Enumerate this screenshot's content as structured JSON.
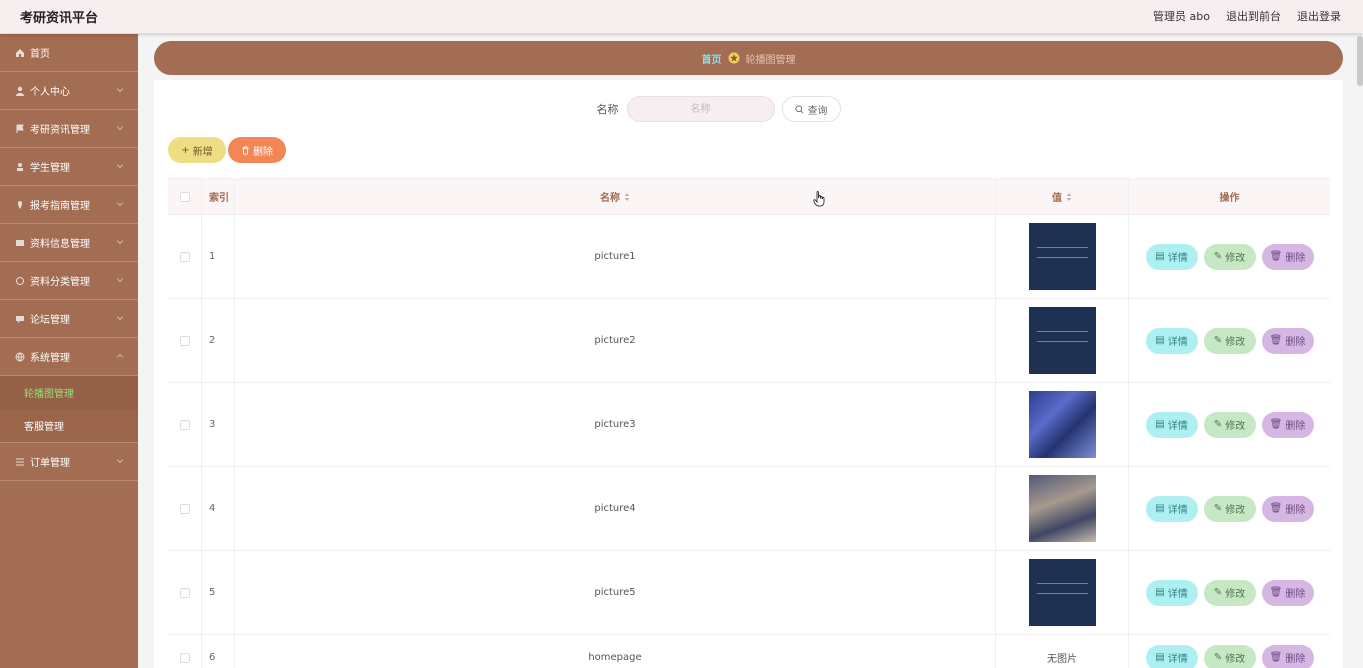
{
  "app": {
    "title": "考研资讯平台",
    "admin_label": "管理员 abo",
    "front_link": "退出到前台",
    "logout_link": "退出登录"
  },
  "sidebar": {
    "items": [
      {
        "label": "首页",
        "icon": "home-icon"
      },
      {
        "label": "个人中心",
        "icon": "user-icon"
      },
      {
        "label": "考研资讯管理",
        "icon": "flag-icon"
      },
      {
        "label": "学生管理",
        "icon": "student-icon"
      },
      {
        "label": "报考指南管理",
        "icon": "guide-icon"
      },
      {
        "label": "资料信息管理",
        "icon": "document-icon"
      },
      {
        "label": "资料分类管理",
        "icon": "category-icon"
      },
      {
        "label": "论坛管理",
        "icon": "forum-icon"
      },
      {
        "label": "系统管理",
        "icon": "globe-icon"
      }
    ],
    "system_sub": [
      {
        "label": "轮播图管理",
        "active": true
      },
      {
        "label": "客服管理",
        "active": false
      }
    ],
    "last_item": {
      "label": "订单管理",
      "icon": "order-icon"
    }
  },
  "breadcrumb": {
    "home": "首页",
    "current": "轮播图管理"
  },
  "search": {
    "label": "名称",
    "placeholder": "名称",
    "query_button": "查询"
  },
  "actions": {
    "add": "新增",
    "delete": "删除"
  },
  "table": {
    "headers": {
      "index": "索引",
      "name": "名称",
      "value": "值",
      "ops": "操作"
    },
    "rows": [
      {
        "index": "1",
        "name": "picture1",
        "thumb": "dark"
      },
      {
        "index": "2",
        "name": "picture2",
        "thumb": "dark"
      },
      {
        "index": "3",
        "name": "picture3",
        "thumb": "blue"
      },
      {
        "index": "4",
        "name": "picture4",
        "thumb": "grey"
      },
      {
        "index": "5",
        "name": "picture5",
        "thumb": "dark"
      },
      {
        "index": "6",
        "name": "homepage",
        "thumb": "none",
        "value_text": "无图片"
      }
    ],
    "op_labels": {
      "detail": "详情",
      "edit": "修改",
      "remove": "删除"
    }
  },
  "colors": {
    "sidebar": "#a26d52",
    "header": "#f7eef0",
    "active_sub": "#9be07a",
    "add_button": "#eedd82",
    "delete_button": "#f48555"
  }
}
